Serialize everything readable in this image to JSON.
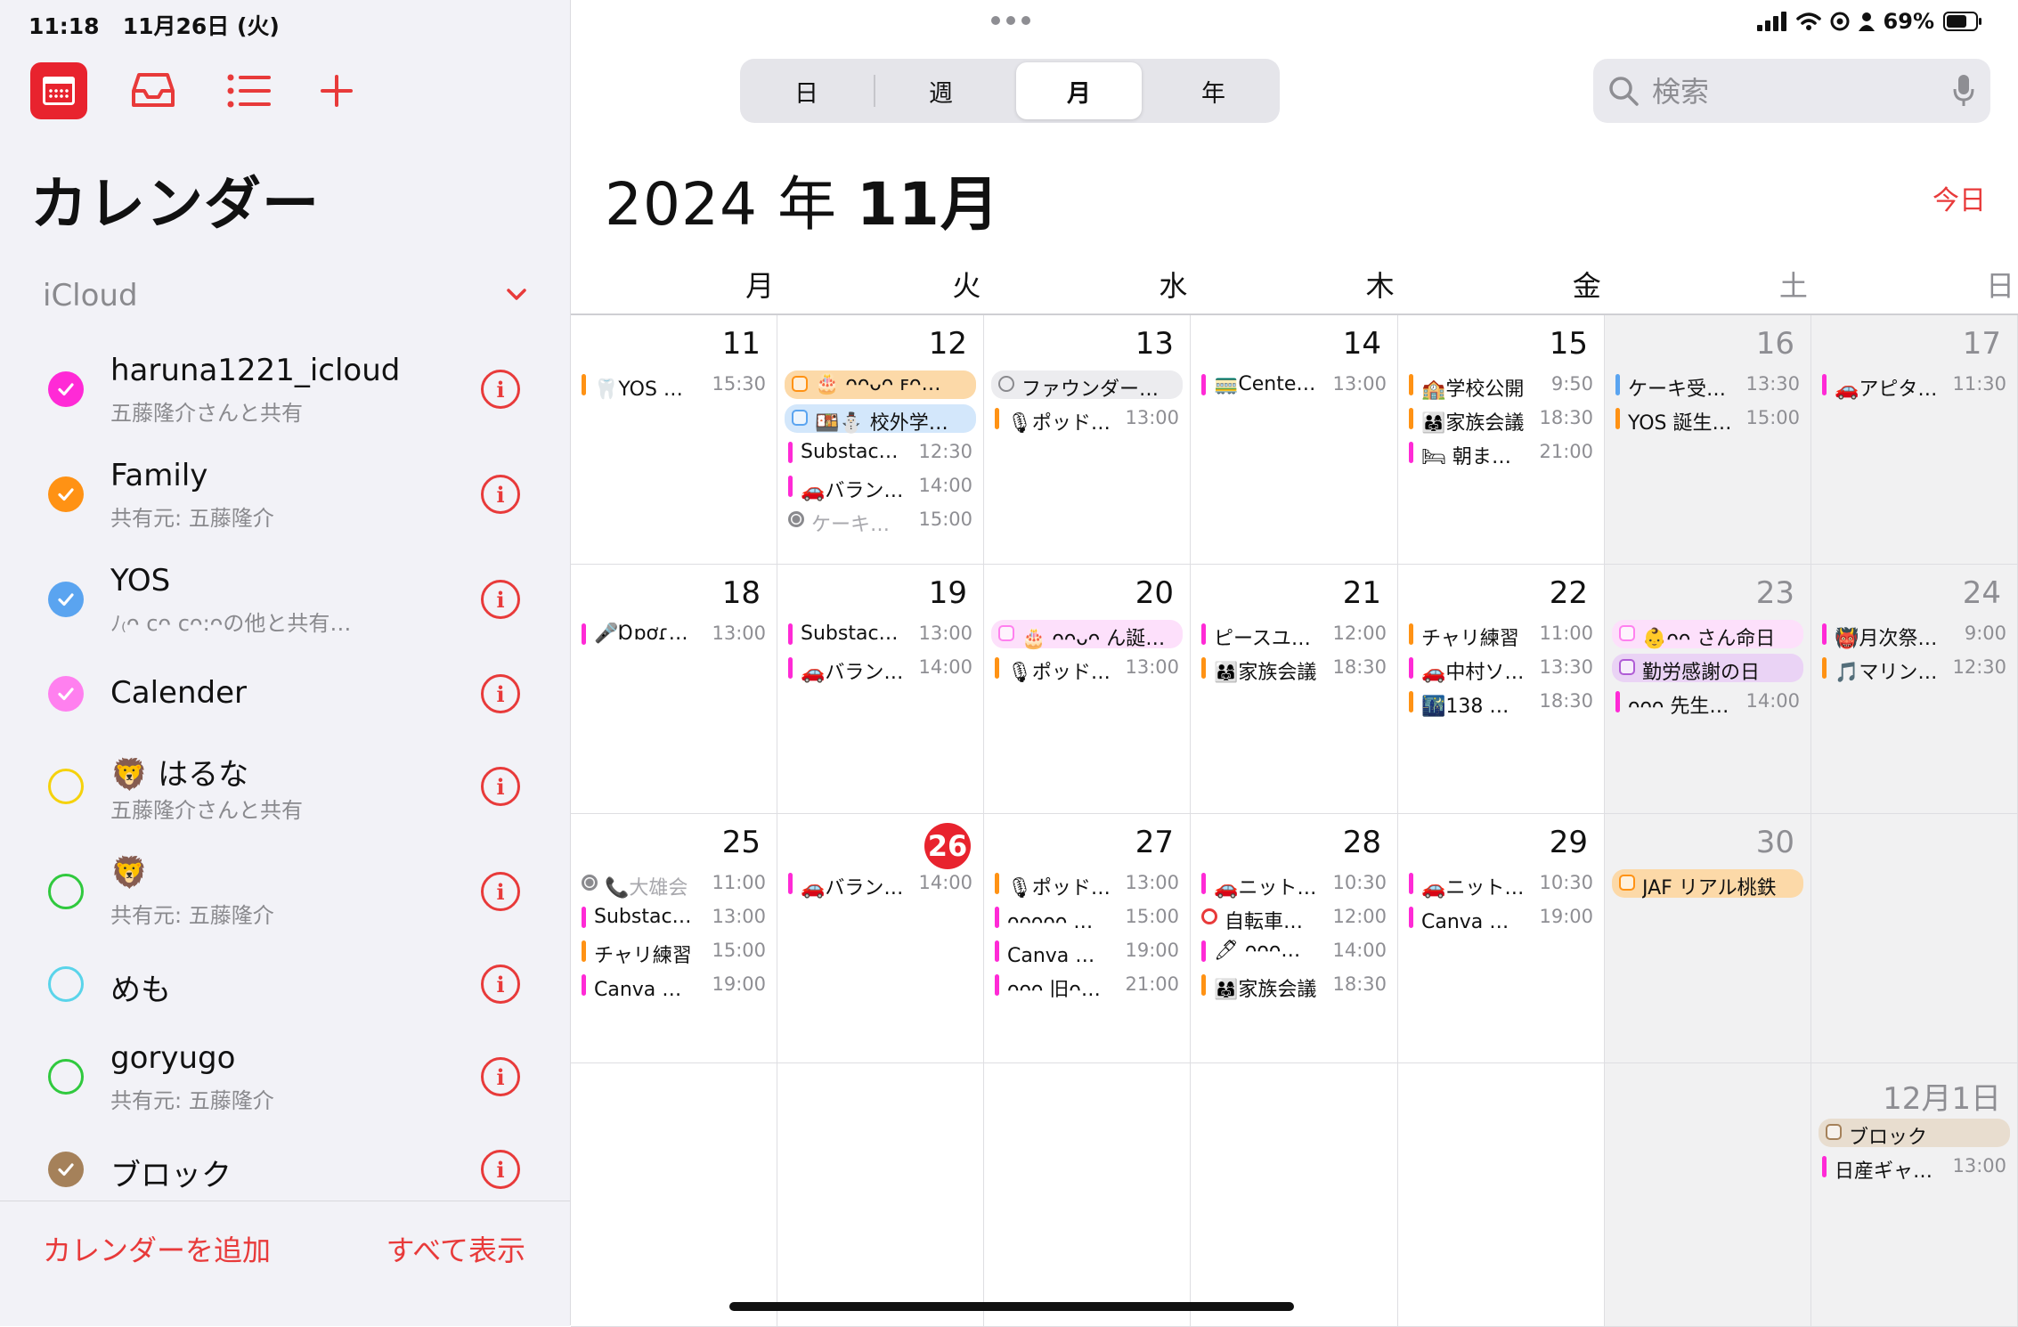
{
  "status": {
    "time": "11:18",
    "date": "11月26日 (火)",
    "battery": "69%"
  },
  "sidebar": {
    "title": "カレンダー",
    "section": "iCloud",
    "calendars": [
      {
        "name": "haruna1221_icloud",
        "sub": "五藤隆介さんと共有",
        "color": "#ff2ad6",
        "checked": true
      },
      {
        "name": "Family",
        "sub": "共有元: 五藤隆介",
        "color": "#ff9214",
        "checked": true
      },
      {
        "name": "YOS",
        "sub": "ﾉ₍ᴖ ϲᴖ ϲᴖ꞉ᴖの他と共有…",
        "color": "#5aa4f0",
        "checked": true
      },
      {
        "name": "Calender",
        "sub": "",
        "color": "#ff80ef",
        "checked": true
      },
      {
        "name": "🦁 はるな",
        "sub": "五藤隆介さんと共有",
        "color": "#f5d20c",
        "checked": false
      },
      {
        "name": "🦁",
        "sub": "共有元: 五藤隆介",
        "color": "#30c93e",
        "checked": false
      },
      {
        "name": "めも",
        "sub": "",
        "color": "#5ad4ea",
        "checked": false
      },
      {
        "name": "goryugo",
        "sub": "共有元: 五藤隆介",
        "color": "#30c93e",
        "checked": false
      },
      {
        "name": "ブロック",
        "sub": "",
        "color": "#a5815a",
        "checked": true
      }
    ],
    "footer": {
      "add": "カレンダーを追加",
      "show_all": "すべて表示"
    }
  },
  "toolbar": {
    "segments": [
      "日",
      "週",
      "月",
      "年"
    ],
    "active_segment": "月",
    "search_placeholder": "検索"
  },
  "calendar": {
    "year_part": "2024 年 ",
    "month_part": "11月",
    "today_label": "今日",
    "weekdays": [
      "月",
      "火",
      "水",
      "木",
      "金",
      "土",
      "日"
    ],
    "weeks": [
      {
        "days": [
          {
            "num": "11",
            "events": [
              {
                "t": "🦷YOS 歯…",
                "time": "15:30",
                "c": "#ff9214",
                "k": "bar"
              }
            ]
          },
          {
            "num": "12",
            "events": [
              {
                "t": "🎂 ᴖᴖᴗᴖ ꜰᴖ…",
                "time": "",
                "c": "#ff9214",
                "k": "allday",
                "bg": "#fcd9a8"
              },
              {
                "t": "🍱⛄ 校外学…",
                "time": "",
                "c": "#5aa4f0",
                "k": "allday",
                "bg": "#d3e7fb"
              },
              {
                "t": "Substack ·…",
                "time": "12:30",
                "c": "#ff2ad6",
                "k": "bar"
              },
              {
                "t": "🚗バラン…",
                "time": "14:00",
                "c": "#ff2ad6",
                "k": "bar"
              },
              {
                "t": "ケーキ買…",
                "time": "15:00",
                "c": "#8a8a8e",
                "k": "done"
              }
            ]
          },
          {
            "num": "13",
            "events": [
              {
                "t": "ファウンダー…",
                "time": "",
                "c": "#8a8a8e",
                "k": "allday",
                "bg": "#ececef",
                "ring": true
              },
              {
                "t": "🎙ポッド…",
                "time": "13:00",
                "c": "#ff9214",
                "k": "bar"
              }
            ]
          },
          {
            "num": "14",
            "events": [
              {
                "t": "🚃Center…",
                "time": "13:00",
                "c": "#ff2ad6",
                "k": "bar"
              }
            ]
          },
          {
            "num": "15",
            "events": [
              {
                "t": "🏫学校公開",
                "time": "9:50",
                "c": "#ff9214",
                "k": "bar"
              },
              {
                "t": "👨‍👩‍👧家族会議",
                "time": "18:30",
                "c": "#ff9214",
                "k": "bar"
              },
              {
                "t": "🛏 朝まで…",
                "time": "21:00",
                "c": "#ff2ad6",
                "k": "bar"
              }
            ]
          },
          {
            "num": "16",
            "weekend": true,
            "events": [
              {
                "t": "ケーキ受け…",
                "time": "13:30",
                "c": "#5aa4f0",
                "k": "bar"
              },
              {
                "t": "YOS 誕生…",
                "time": "15:00",
                "c": "#ff9214",
                "k": "bar"
              }
            ]
          },
          {
            "num": "17",
            "weekend": true,
            "events": [
              {
                "t": "🚗アピタ…",
                "time": "11:30",
                "c": "#ff2ad6",
                "k": "bar"
              }
            ]
          }
        ]
      },
      {
        "days": [
          {
            "num": "18",
            "events": [
              {
                "t": "🎤Ɒɒơɾᴗ…",
                "time": "13:00",
                "c": "#ff2ad6",
                "k": "bar"
              }
            ]
          },
          {
            "num": "19",
            "events": [
              {
                "t": "Substack ·…",
                "time": "13:00",
                "c": "#ff2ad6",
                "k": "bar"
              },
              {
                "t": "🚗バラン…",
                "time": "14:00",
                "c": "#ff2ad6",
                "k": "bar"
              }
            ]
          },
          {
            "num": "20",
            "events": [
              {
                "t": "🎂 ᴖᴖᴗᴖ ん誕…",
                "time": "",
                "c": "#ff80ef",
                "k": "allday",
                "bg": "#fde0fb"
              },
              {
                "t": "🎙ポッド…",
                "time": "13:00",
                "c": "#ff9214",
                "k": "bar"
              }
            ]
          },
          {
            "num": "21",
            "events": [
              {
                "t": "ピースユー…",
                "time": "12:00",
                "c": "#ff2ad6",
                "k": "bar"
              },
              {
                "t": "👨‍👩‍👧家族会議",
                "time": "18:30",
                "c": "#ff9214",
                "k": "bar"
              }
            ]
          },
          {
            "num": "22",
            "events": [
              {
                "t": "チャリ練習",
                "time": "11:00",
                "c": "#ff9214",
                "k": "bar"
              },
              {
                "t": "🚗中村ソ…",
                "time": "13:30",
                "c": "#ff2ad6",
                "k": "bar"
              },
              {
                "t": "🌃138 ウ…",
                "time": "18:30",
                "c": "#ff9214",
                "k": "bar"
              }
            ]
          },
          {
            "num": "23",
            "weekend": true,
            "events": [
              {
                "t": "👶ᴖᴖ さん命日",
                "time": "",
                "c": "#ff80ef",
                "k": "allday",
                "bg": "#fde0fb"
              },
              {
                "t": "勤労感謝の日",
                "time": "",
                "c": "#b05cd6",
                "k": "allday",
                "bg": "#ead3f5"
              },
              {
                "t": "ᴖᴖᴖ 先生…",
                "time": "14:00",
                "c": "#ff2ad6",
                "k": "bar"
              }
            ]
          },
          {
            "num": "24",
            "weekend": true,
            "events": [
              {
                "t": "👹月次祭で…",
                "time": "9:00",
                "c": "#ff2ad6",
                "k": "bar"
              },
              {
                "t": "🎵マリン…",
                "time": "12:30",
                "c": "#ff9214",
                "k": "bar"
              }
            ]
          }
        ]
      },
      {
        "days": [
          {
            "num": "25",
            "events": [
              {
                "t": "📞大雄会",
                "time": "11:00",
                "c": "#8a8a8e",
                "k": "done"
              },
              {
                "t": "Substack ·…",
                "time": "13:00",
                "c": "#ff2ad6",
                "k": "bar"
              },
              {
                "t": "チャリ練習",
                "time": "15:00",
                "c": "#ff9214",
                "k": "bar"
              },
              {
                "t": "Canva ワー…",
                "time": "19:00",
                "c": "#ff2ad6",
                "k": "bar"
              }
            ]
          },
          {
            "num": "26",
            "today": true,
            "events": [
              {
                "t": "🚗バラン…",
                "time": "14:00",
                "c": "#ff2ad6",
                "k": "bar"
              }
            ]
          },
          {
            "num": "27",
            "events": [
              {
                "t": "🎙ポッド…",
                "time": "13:00",
                "c": "#ff9214",
                "k": "bar"
              },
              {
                "t": "ᴖᴖᴖᴖᴖ リ…",
                "time": "15:00",
                "c": "#ff2ad6",
                "k": "bar"
              },
              {
                "t": "Canva ワ…",
                "time": "19:00",
                "c": "#ff2ad6",
                "k": "bar"
              },
              {
                "t": "ᴖᴖᴖ 旧ᴖ…",
                "time": "21:00",
                "c": "#ff2ad6",
                "k": "bar"
              }
            ]
          },
          {
            "num": "28",
            "events": [
              {
                "t": "🚗ニット…",
                "time": "10:30",
                "c": "#ff2ad6",
                "k": "bar"
              },
              {
                "t": "自転車屋…",
                "time": "12:00",
                "c": "#e83a3a",
                "k": "ring"
              },
              {
                "t": "🖊 ᴖᴖᴖ…",
                "time": "14:00",
                "c": "#ff2ad6",
                "k": "bar"
              },
              {
                "t": "👨‍👩‍👧家族会議",
                "time": "18:30",
                "c": "#ff9214",
                "k": "bar"
              }
            ]
          },
          {
            "num": "29",
            "events": [
              {
                "t": "🚗ニット…",
                "time": "10:30",
                "c": "#ff2ad6",
                "k": "bar"
              },
              {
                "t": "Canva ワ…",
                "time": "19:00",
                "c": "#ff2ad6",
                "k": "bar"
              }
            ]
          },
          {
            "num": "30",
            "weekend": true,
            "events": [
              {
                "t": "JAF リアル桃鉄",
                "time": "",
                "c": "#ff9214",
                "k": "allday",
                "bg": "#fcd9a8"
              }
            ]
          },
          {
            "num": "",
            "weekend": true,
            "events": []
          }
        ]
      },
      {
        "days": [
          {
            "num": "",
            "events": []
          },
          {
            "num": "",
            "events": []
          },
          {
            "num": "",
            "events": []
          },
          {
            "num": "",
            "events": []
          },
          {
            "num": "",
            "events": []
          },
          {
            "num": "",
            "weekend": true,
            "events": []
          },
          {
            "num": "12月1日",
            "weekend": true,
            "events": [
              {
                "t": "ブロック",
                "time": "",
                "c": "#a5815a",
                "k": "allday",
                "bg": "#e8ddcf"
              },
              {
                "t": "日産ギャラ…",
                "time": "13:00",
                "c": "#ff2ad6",
                "k": "bar"
              }
            ]
          }
        ]
      }
    ]
  }
}
